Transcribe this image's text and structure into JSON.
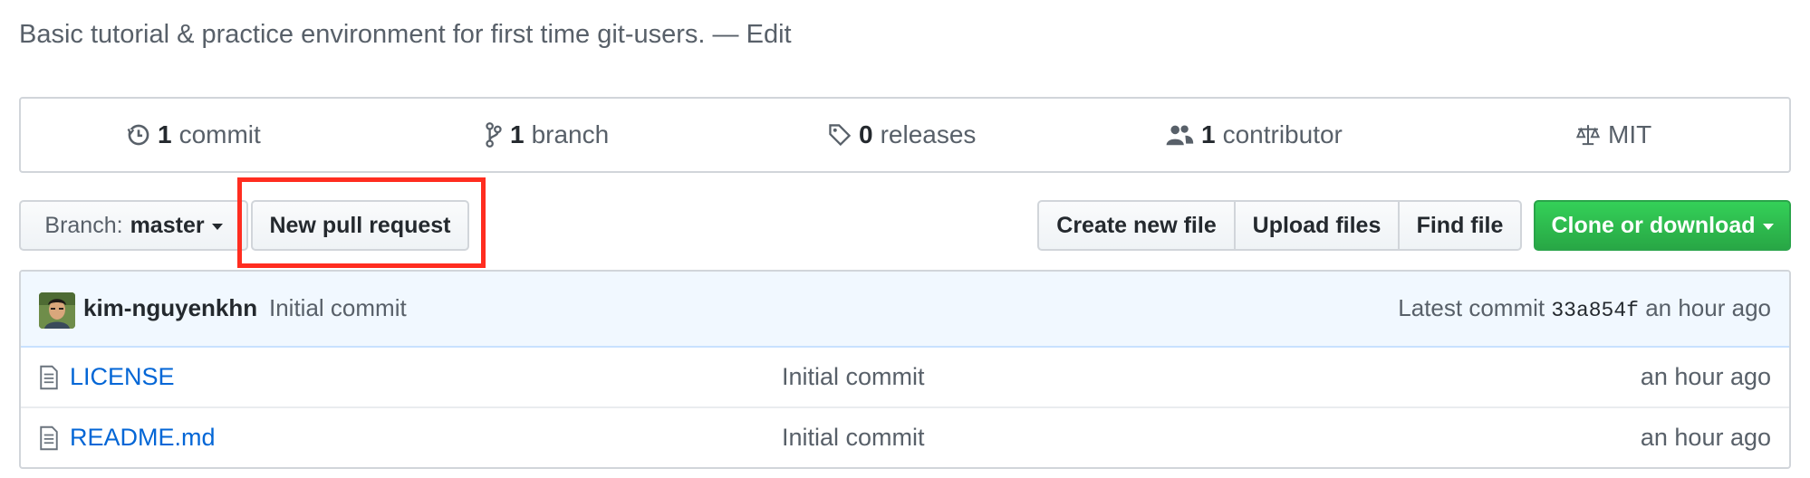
{
  "repo": {
    "description": "Basic tutorial & practice environment for first time git-users.",
    "separator": "—",
    "edit_label": "Edit"
  },
  "summary": {
    "commits": {
      "count": "1",
      "label": "commit",
      "icon": "history-icon"
    },
    "branches": {
      "count": "1",
      "label": "branch",
      "icon": "git-branch-icon"
    },
    "releases": {
      "count": "0",
      "label": "releases",
      "icon": "tag-icon"
    },
    "contributors": {
      "count": "1",
      "label": "contributor",
      "icon": "people-icon"
    },
    "license": {
      "label": "MIT",
      "icon": "law-icon"
    }
  },
  "toolbar": {
    "branch_prefix": "Branch:",
    "branch_name": "master",
    "new_pr_label": "New pull request",
    "create_file_label": "Create new file",
    "upload_label": "Upload files",
    "find_label": "Find file",
    "clone_label": "Clone or download"
  },
  "latest_commit": {
    "author": "kim-nguyenkhn",
    "message": "Initial commit",
    "prefix": "Latest commit",
    "sha": "33a854f",
    "age": "an hour ago"
  },
  "files": [
    {
      "name": "LICENSE",
      "message": "Initial commit",
      "age": "an hour ago",
      "icon": "file-text-icon"
    },
    {
      "name": "README.md",
      "message": "Initial commit",
      "age": "an hour ago",
      "icon": "file-text-icon"
    }
  ],
  "colors": {
    "link": "#0366d6",
    "clone_button": "#28a745",
    "highlight_box": "#ff2d20",
    "commit_tease_bg": "#f1f8ff"
  }
}
